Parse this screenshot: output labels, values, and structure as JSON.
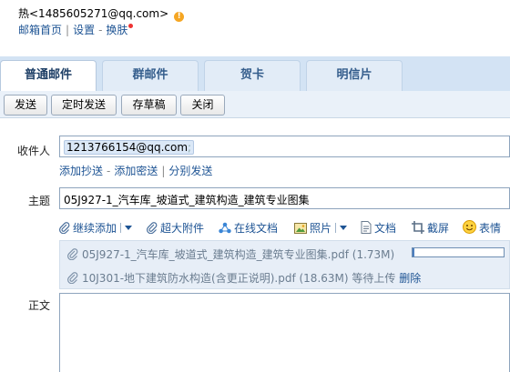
{
  "header": {
    "user": "热<1485605271@qq.com>",
    "links": [
      "邮箱首页",
      "设置",
      "换肤"
    ]
  },
  "tabs": [
    {
      "label": "普通邮件",
      "active": true
    },
    {
      "label": "群邮件",
      "active": false
    },
    {
      "label": "贺卡",
      "active": false
    },
    {
      "label": "明信片",
      "active": false
    }
  ],
  "toolbar": {
    "send": "发送",
    "scheduled_send": "定时发送",
    "save_draft": "存草稿",
    "close": "关闭"
  },
  "form": {
    "to_label": "收件人",
    "to_value": "1213766154@qq.com",
    "to_separator": ";",
    "cc_link": "添加抄送",
    "bcc_link": "添加密送",
    "separate_link": "分别发送",
    "subject_label": "主题",
    "subject_value": "05J927-1_汽车库_坡道式_建筑构造_建筑专业图集",
    "body_label": "正文"
  },
  "attach_toolbar": {
    "continue_add": "继续添加",
    "large_attachment": "超大附件",
    "online_doc": "在线文档",
    "photo": "照片",
    "document": "文档",
    "screenshot": "截屏",
    "emoji": "表情"
  },
  "attachments": [
    {
      "name": "05J927-1_汽车库_坡道式_建筑构造_建筑专业图集.pdf (1.73M)",
      "progress": 0.02
    },
    {
      "name": "10J301-地下建筑防水构造(含更正说明).pdf (18.63M)",
      "status": "等待上传",
      "action": "删除"
    }
  ],
  "colors": {
    "link": "#1e5494",
    "tab_bar": "#d3e3f4",
    "toolbar": "#eaf1f9",
    "attachment_bg": "#e7eef7",
    "warning": "#f5a623"
  }
}
